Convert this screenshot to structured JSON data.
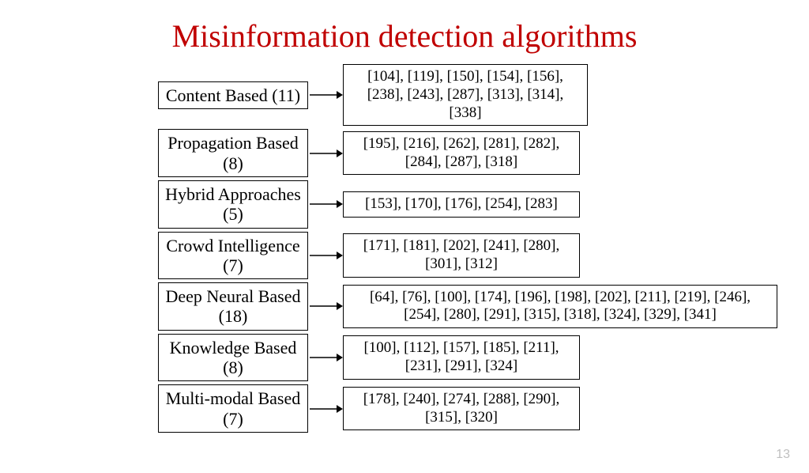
{
  "title": "Misinformation detection algorithms",
  "page_number": "13",
  "rows": [
    {
      "label": "Content Based (11)",
      "refs": "[104], [119], [150], [154], [156], [238], [243], [287], [313], [314], [338]",
      "width": "med"
    },
    {
      "label": "Propagation Based (8)",
      "refs": "[195], [216], [262], [281], [282], [284], [287], [318]",
      "width": "short"
    },
    {
      "label": "Hybrid Approaches (5)",
      "refs": "[153], [170], [176], [254], [283]",
      "width": "short"
    },
    {
      "label": "Crowd Intelligence (7)",
      "refs": "[171], [181], [202], [241], [280], [301], [312]",
      "width": "short"
    },
    {
      "label": "Deep Neural Based (18)",
      "refs": "[64], [76], [100], [174], [196], [198], [202], [211], [219], [246], [254], [280], [291], [315], [318], [324], [329], [341]",
      "width": "wide"
    },
    {
      "label": "Knowledge Based (8)",
      "refs": "[100], [112], [157], [185], [211], [231], [291], [324]",
      "width": "short"
    },
    {
      "label": "Multi-modal Based (7)",
      "refs": "[178], [240], [274], [288], [290], [315], [320]",
      "width": "short"
    }
  ]
}
